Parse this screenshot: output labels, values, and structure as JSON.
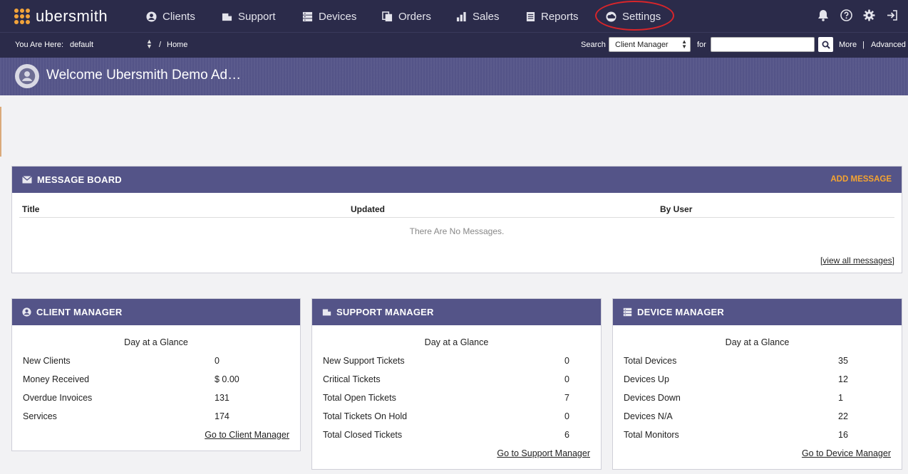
{
  "app": {
    "name": "ubersmith"
  },
  "nav": {
    "items": [
      {
        "label": "Clients",
        "icon": "user-circle-icon"
      },
      {
        "label": "Support",
        "icon": "ticket-icon"
      },
      {
        "label": "Devices",
        "icon": "server-icon"
      },
      {
        "label": "Orders",
        "icon": "copy-icon"
      },
      {
        "label": "Sales",
        "icon": "bar-chart-icon"
      },
      {
        "label": "Reports",
        "icon": "document-icon"
      },
      {
        "label": "Settings",
        "icon": "cloud-icon"
      }
    ],
    "right_icons": [
      "bell-icon",
      "help-icon",
      "gear-icon",
      "logout-icon"
    ]
  },
  "breadcrumb": {
    "you_are_here": "You Are Here:",
    "context": "default",
    "separator": "/",
    "page": "Home"
  },
  "search": {
    "label": "Search",
    "scope": "Client Manager",
    "for_label": "for",
    "value": "",
    "more": "More",
    "divider": "|",
    "advanced": "Advanced"
  },
  "welcome": {
    "title": "Welcome Ubersmith Demo Ad…"
  },
  "message_board": {
    "title": "MESSAGE BOARD",
    "add_label": "ADD MESSAGE",
    "columns": [
      "Title",
      "Updated",
      "By User"
    ],
    "empty_text": "There Are No Messages.",
    "view_all_open": "[",
    "view_all": "view all messages",
    "view_all_close": "]"
  },
  "client_manager": {
    "title": "CLIENT MANAGER",
    "subtitle": "Day at a Glance",
    "rows": [
      {
        "label": "New Clients",
        "value": "0"
      },
      {
        "label": "Money Received",
        "value": "$ 0.00"
      },
      {
        "label": "Overdue Invoices",
        "value": "131"
      },
      {
        "label": "Services",
        "value": "174"
      }
    ],
    "link": "Go to Client Manager"
  },
  "support_manager": {
    "title": "SUPPORT MANAGER",
    "subtitle": "Day at a Glance",
    "rows": [
      {
        "label": "New Support Tickets",
        "value": "0"
      },
      {
        "label": "Critical Tickets",
        "value": "0"
      },
      {
        "label": "Total Open Tickets",
        "value": "7"
      },
      {
        "label": "Total Tickets On Hold",
        "value": "0"
      },
      {
        "label": "Total Closed Tickets",
        "value": "6"
      }
    ],
    "link": "Go to Support Manager"
  },
  "device_manager": {
    "title": "DEVICE MANAGER",
    "subtitle": "Day at a Glance",
    "rows": [
      {
        "label": "Total Devices",
        "value": "35"
      },
      {
        "label": "Devices Up",
        "value": "12"
      },
      {
        "label": "Devices Down",
        "value": "1"
      },
      {
        "label": "Devices N/A",
        "value": "22"
      },
      {
        "label": "Total Monitors",
        "value": "16"
      }
    ],
    "link": "Go to Device Manager"
  },
  "colors": {
    "nav_bg": "#2b2b4a",
    "panel_header": "#545488",
    "accent_orange": "#f5a430",
    "highlight_ring": "#d8252a"
  }
}
